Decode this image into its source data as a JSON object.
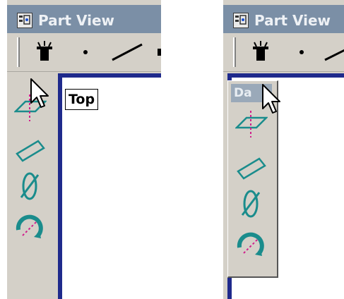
{
  "colors": {
    "title_bar": "#7b8fa6",
    "face": "#d4d0c8",
    "canvas_border": "#1f2a8c",
    "tool_teal": "#1a8c8c",
    "tool_magenta": "#d0208c"
  },
  "left_panel": {
    "title": "Part View",
    "tooltip": "Top",
    "toolbar_icons": [
      "magic-hat-icon",
      "point-icon",
      "line-icon"
    ],
    "palette_tools": [
      "top-plane-icon",
      "rectangle-plane-icon",
      "ellipse-plane-icon",
      "rotate-view-icon"
    ]
  },
  "right_panel": {
    "title": "Part View",
    "flyout_caption": "Da",
    "toolbar_icons": [
      "magic-hat-icon",
      "point-icon",
      "line-icon"
    ],
    "palette_tools": [
      "top-plane-icon",
      "rectangle-plane-icon",
      "ellipse-plane-icon",
      "rotate-view-icon"
    ]
  }
}
